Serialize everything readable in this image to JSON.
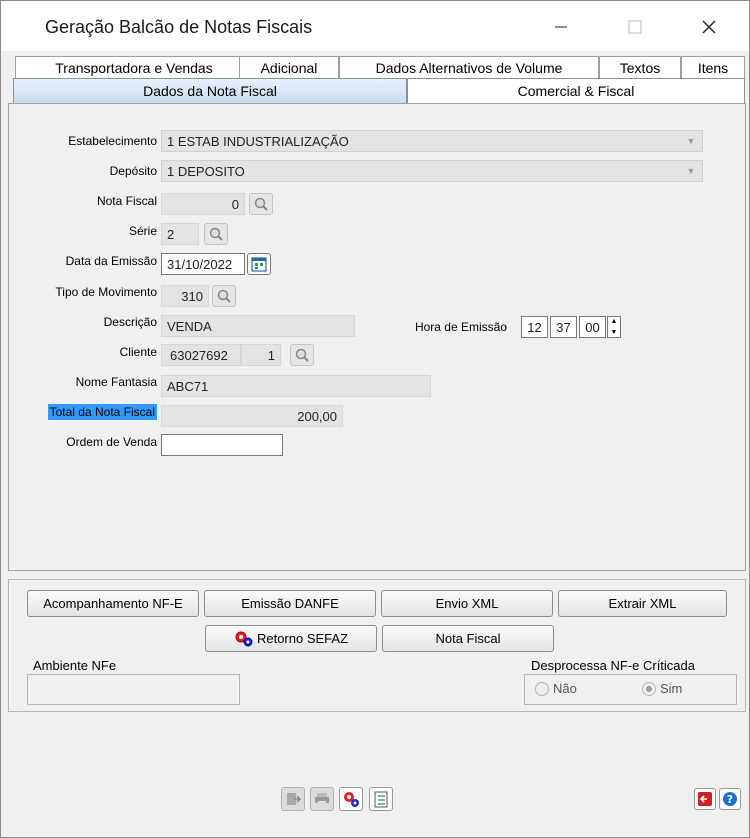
{
  "window": {
    "title": "Geração Balcão de Notas Fiscais"
  },
  "tabs_row1": [
    {
      "label": "Transportadora e Vendas"
    },
    {
      "label": "Adicional"
    },
    {
      "label": "Dados Alternativos de Volume"
    },
    {
      "label": "Textos"
    },
    {
      "label": "Itens"
    }
  ],
  "tabs_row2": [
    {
      "label": "Dados da Nota Fiscal",
      "active": true
    },
    {
      "label": "Comercial & Fiscal",
      "active": false
    }
  ],
  "form": {
    "estabelecimento": {
      "label": "Estabelecimento",
      "value": "1 ESTAB INDUSTRIALIZAÇÃO"
    },
    "deposito": {
      "label": "Depósito",
      "value": "1 DEPOSITO"
    },
    "nota_fiscal": {
      "label": "Nota Fiscal",
      "value": "0"
    },
    "serie": {
      "label": "Série",
      "value": "2"
    },
    "data_emissao": {
      "label": "Data da Emissão",
      "value": "31/10/2022"
    },
    "tipo_movimento": {
      "label": "Tipo de Movimento",
      "value": "310"
    },
    "descricao": {
      "label": "Descrição",
      "value": "VENDA"
    },
    "hora_emissao": {
      "label": "Hora de Emissão",
      "hh": "12",
      "mm": "37",
      "ss": "00"
    },
    "cliente": {
      "label": "Cliente",
      "code": "63027692",
      "seq": "1"
    },
    "nome_fantasia": {
      "label": "Nome Fantasia",
      "value": "ABC71"
    },
    "total_nota": {
      "label": "Total da Nota Fiscal",
      "value": "200,00"
    },
    "ordem_venda": {
      "label": "Ordem de Venda",
      "value": ""
    }
  },
  "buttons": {
    "acompanhamento": "Acompanhamento NF-E",
    "emissao_danfe": "Emissão DANFE",
    "envio_xml": "Envio XML",
    "extrair_xml": "Extrair XML",
    "retorno_sefaz": "Retorno SEFAZ",
    "nota_fiscal": "Nota Fiscal"
  },
  "ambiente": {
    "title": "Ambiente NFe",
    "value": ""
  },
  "desprocessa": {
    "title": "Desprocessa NF-e Críticada",
    "options": [
      {
        "label": "Não",
        "checked": false
      },
      {
        "label": "Sim",
        "checked": true
      }
    ]
  },
  "colors": {
    "tab_active": "#c9dcf0",
    "highlight": "#3399ff",
    "panel_bg": "#f0f0f0"
  }
}
